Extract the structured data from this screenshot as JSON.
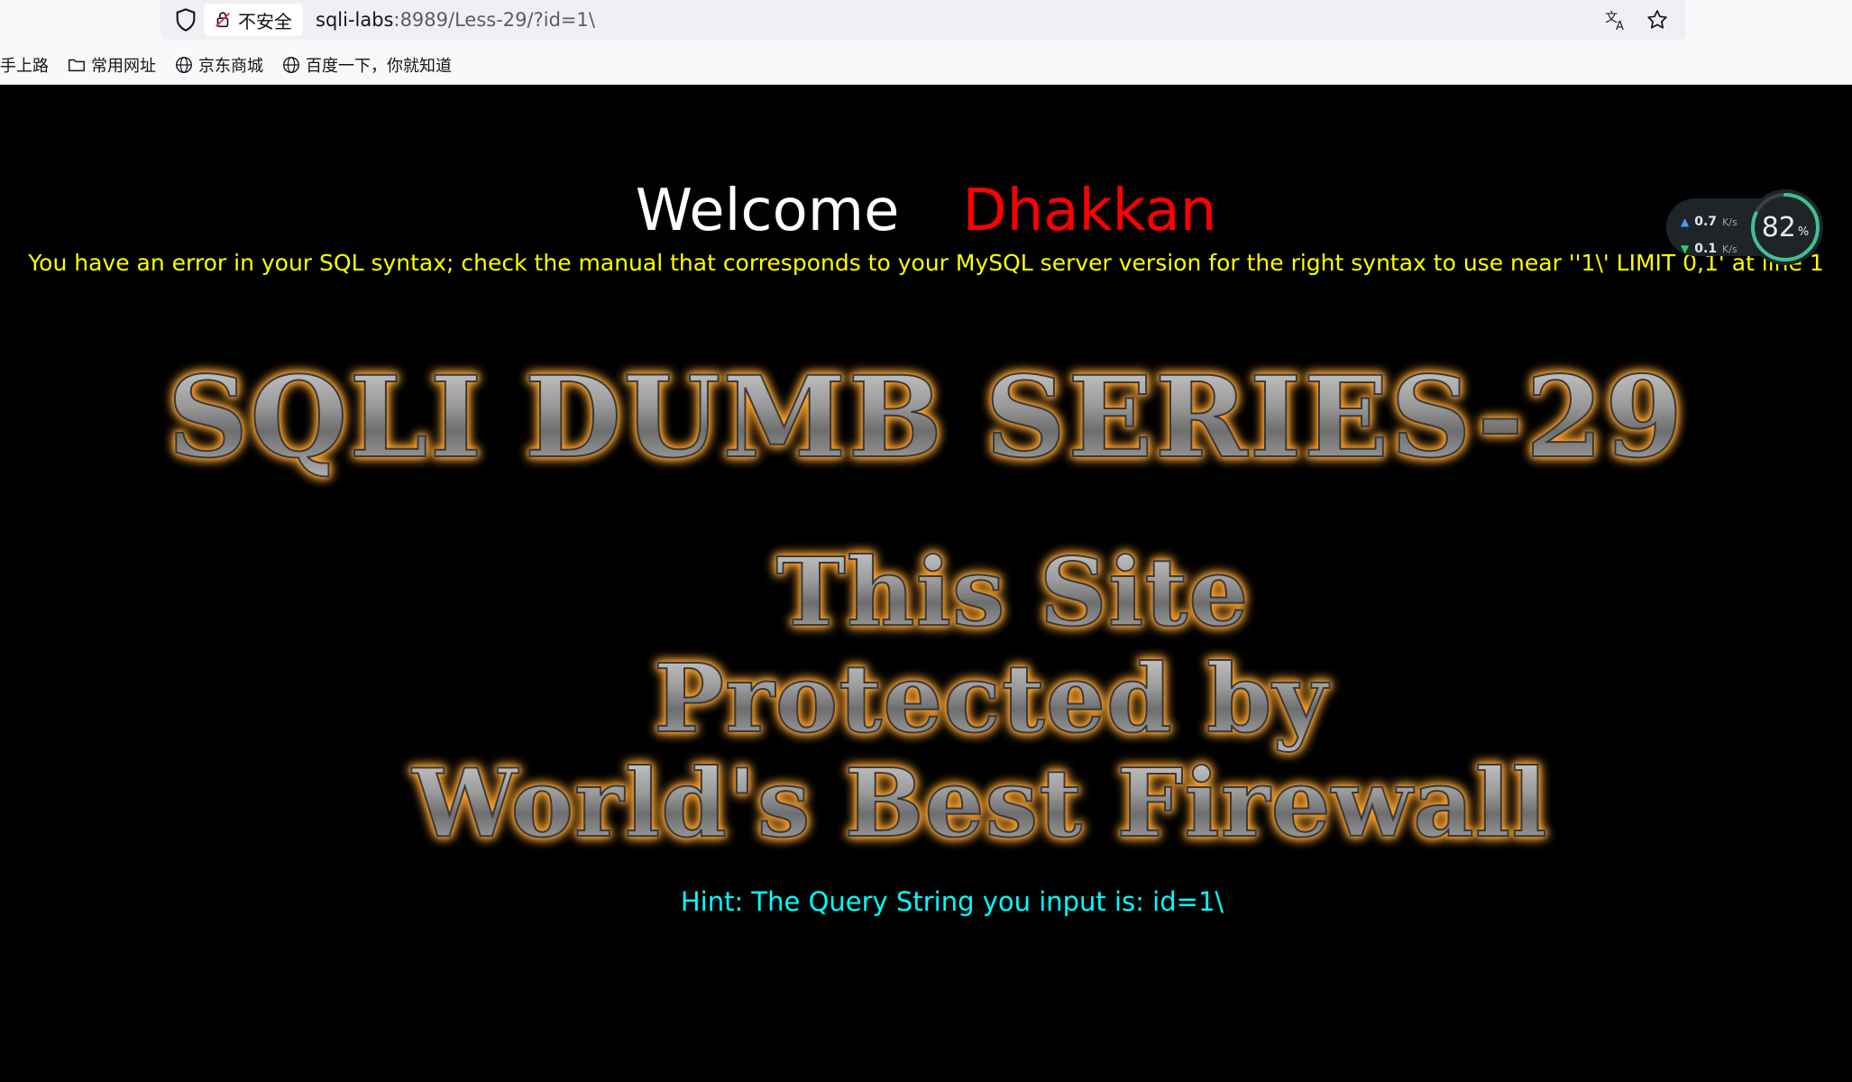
{
  "browser": {
    "security_label": "不安全",
    "url_host": "sqli-labs",
    "url_rest": ":8989/Less-29/?id=1\\",
    "bookmarks": [
      {
        "label": "手上路",
        "icon": "none"
      },
      {
        "label": "常用网址",
        "icon": "folder-icon"
      },
      {
        "label": "京东商城",
        "icon": "globe-icon"
      },
      {
        "label": "百度一下，你就知道",
        "icon": "globe-icon"
      }
    ]
  },
  "page": {
    "welcome_word": "Welcome",
    "welcome_name": "Dhakkan",
    "sql_error": "You have an error in your SQL syntax; check the manual that corresponds to your MySQL server version for the right syntax to use near ''1\\' LIMIT 0,1' at line 1",
    "banner": "SQLI DUMB SERIES-29",
    "firewall_lines": [
      "This Site",
      "Protected by",
      "World's Best Firewall"
    ],
    "hint": "Hint: The Query String you input is: id=1\\"
  },
  "netmon": {
    "upload": "0.7",
    "download": "0.1",
    "unit": "K/s",
    "percent": "82",
    "percent_sign": "%",
    "percent_value": 0.82
  },
  "colors": {
    "welcome_word": "#ffffff",
    "welcome_name": "#ff0000",
    "sql_error": "#ffff00",
    "hint": "#00ffff",
    "glow": "#ff9a1f"
  }
}
